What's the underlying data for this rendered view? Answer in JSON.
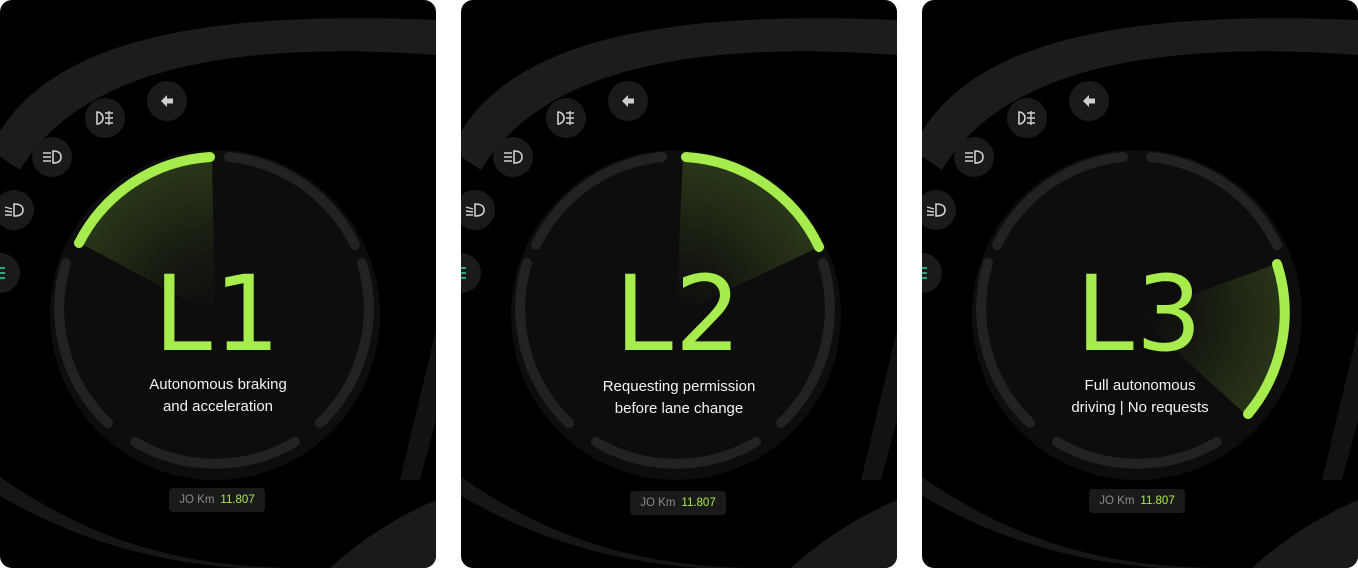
{
  "panels": [
    {
      "level": "L1",
      "description_line1": "Autonomous braking",
      "description_line2": "and acceleration",
      "odometer_label": "JO Km",
      "odometer_value": "11.807",
      "active_segment": "upper-left"
    },
    {
      "level": "L2",
      "description_line1": "Requesting permission",
      "description_line2": "before lane change",
      "odometer_label": "JO Km",
      "odometer_value": "11.807",
      "active_segment": "upper-right"
    },
    {
      "level": "L3",
      "description_line1": "Full autonomous",
      "description_line2": "driving | No requests",
      "odometer_label": "JO Km",
      "odometer_value": "11.807",
      "active_segment": "right"
    }
  ],
  "icons": [
    "back-arrow-icon",
    "fog-light-icon",
    "high-beam-icon",
    "low-beam-icon",
    "parking-light-icon"
  ],
  "colors": {
    "accent": "#a6ec4c",
    "indicator_green": "#2fd6a0",
    "background": "#000000",
    "track": "#222222",
    "bezel": "#1c1c1e",
    "text": "#f2f2f2"
  }
}
